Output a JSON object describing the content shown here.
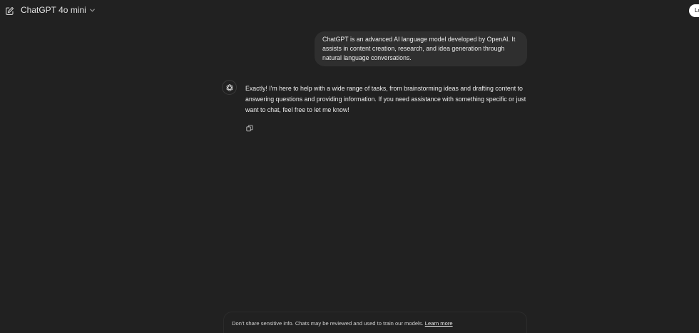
{
  "header": {
    "new_chat_icon": "edit-icon",
    "model_label": "ChatGPT 4o mini",
    "model_chevron_icon": "chevron-down-icon",
    "login_label": "Lo"
  },
  "conversation": {
    "user_message": "ChatGPT is an advanced AI language model developed by OpenAI. It assists in content creation, research, and idea generation through natural language conversations.",
    "assistant_icon": "openai-logo-icon",
    "assistant_message": "Exactly! I'm here to help with a wide range of tasks, from brainstorming ideas and drafting content to answering questions and providing information. If you need assistance with something specific or just want to chat, feel free to let me know!",
    "copy_icon": "copy-icon"
  },
  "footer": {
    "notice_text": "Don't share sensitive info. Chats may be reviewed and used to train our models.",
    "learn_more_label": "Learn more"
  }
}
